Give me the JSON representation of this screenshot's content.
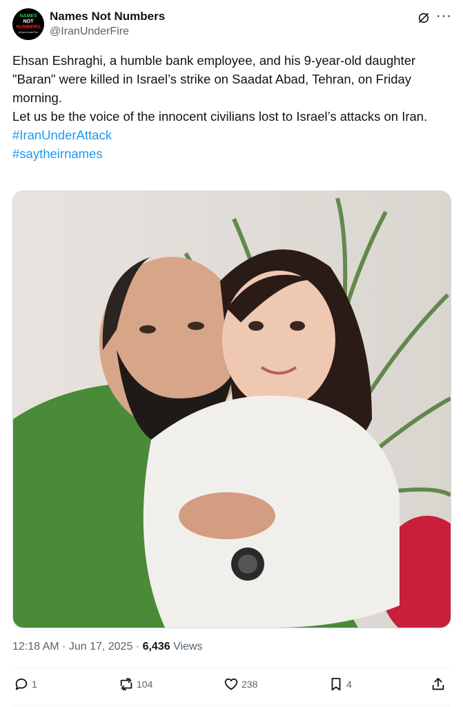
{
  "author": {
    "name": "Names Not Numbers",
    "handle": "@IranUnderFire",
    "avatar_lines": [
      "NAMES",
      "NOT",
      "NUMBERS",
      "@IranUnderFire"
    ]
  },
  "post": {
    "line1": "Ehsan Eshraghi, a humble bank employee, and his 9-year-old daughter \"Baran\" were killed in Israel’s strike on Saadat Abad, Tehran, on Friday morning.",
    "line2": "Let us be the voice of the innocent civilians lost to Israel’s attacks on Iran.",
    "hashtags": [
      "#IranUnderAttack",
      "#saytheirnames"
    ]
  },
  "meta": {
    "time": "12:18 AM",
    "sep": " · ",
    "date": "Jun 17, 2025",
    "views_count": "6,436",
    "views_label": "Views"
  },
  "actions": {
    "replies": "1",
    "reposts": "104",
    "likes": "238",
    "bookmarks": "4"
  },
  "icons": [
    "grok-icon",
    "more-icon",
    "reply-icon",
    "repost-icon",
    "like-icon",
    "bookmark-icon",
    "share-icon"
  ],
  "colors": {
    "link": "#1d9bf0",
    "muted": "#536471",
    "text": "#0f1419"
  }
}
